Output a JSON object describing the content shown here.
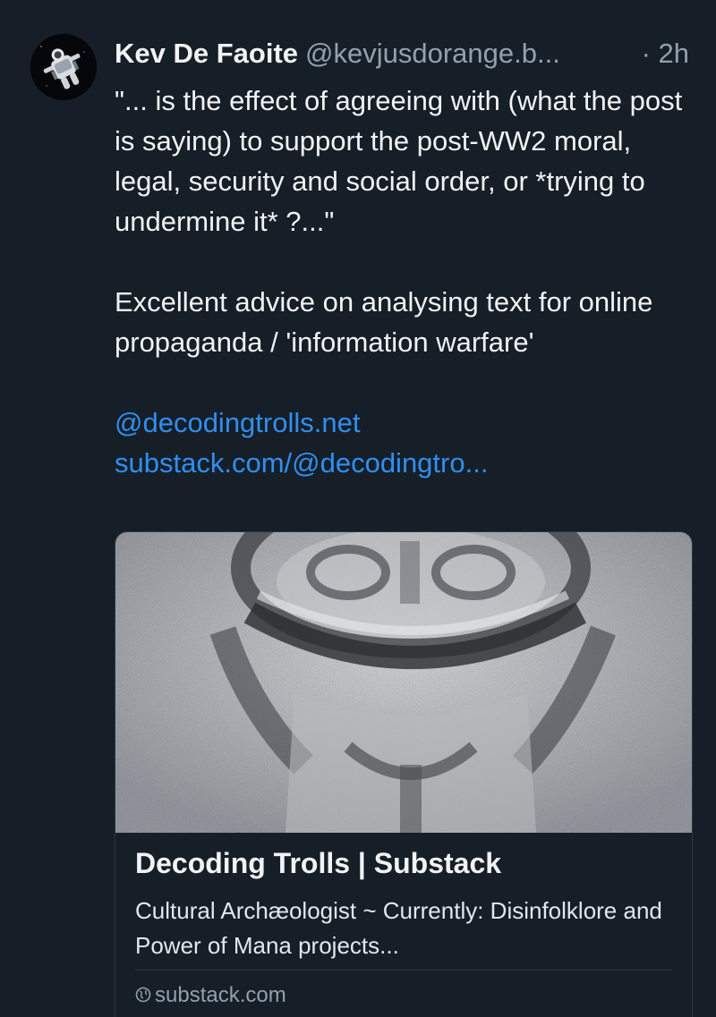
{
  "post": {
    "author_name": "Kev De Faoite",
    "author_handle": "@kevjusdorange.b...",
    "timestamp": "· 2h",
    "paragraphs": [
      "\"... is the effect of agreeing with (what the post is saying) to support the post-WW2 moral, legal, security and social order, or *trying to undermine it* ?...\"",
      "Excellent advice on analysing text for online propaganda / 'information warfare'"
    ],
    "links": [
      "@decodingtrolls.net",
      "substack.com/@decodingtro..."
    ]
  },
  "card": {
    "title": "Decoding Trolls | Substack",
    "description": "Cultural Archæologist ~ Currently: Disinfolklore and Power of Mana projects...",
    "domain": "substack.com",
    "domain_icon": "globe-icon"
  },
  "colors": {
    "background": "#161e27",
    "text": "#f1f3f5",
    "muted": "#93a0ae",
    "link": "#2f8ff1",
    "border": "#2b3643"
  }
}
